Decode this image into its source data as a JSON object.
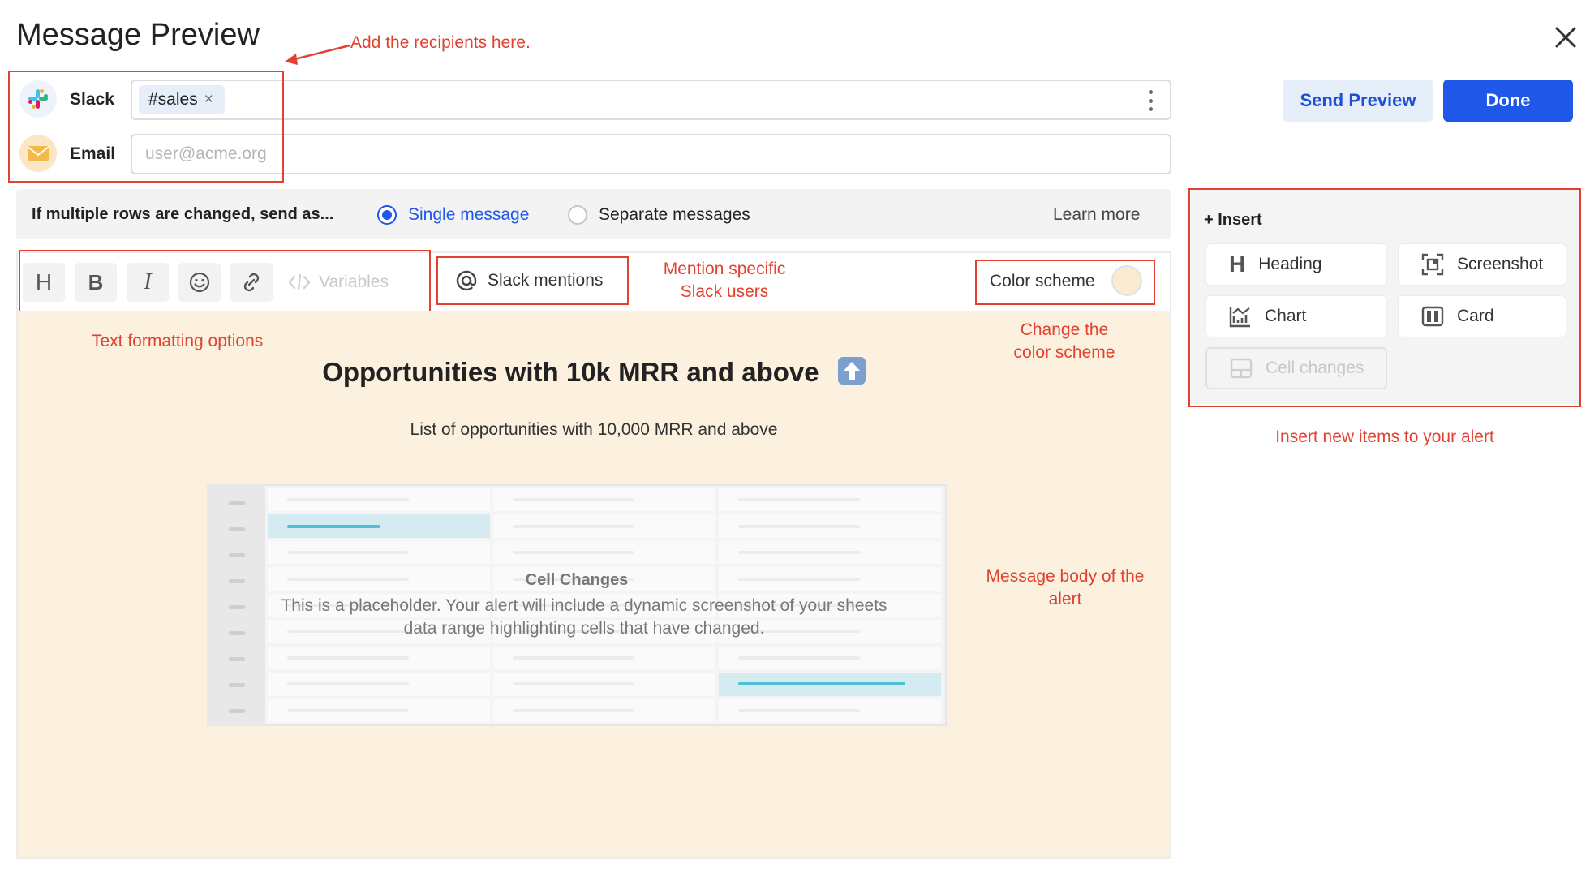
{
  "header": {
    "title": "Message Preview",
    "close_icon": "close-icon"
  },
  "recipients": {
    "slack": {
      "label": "Slack",
      "icon": "slack-icon",
      "chip": "#sales",
      "chip_remove": "×"
    },
    "email": {
      "label": "Email",
      "icon": "envelope-icon",
      "placeholder": "user@acme.org",
      "value": ""
    }
  },
  "actions": {
    "send_preview": "Send Preview",
    "done": "Done"
  },
  "send_mode": {
    "label": "If multiple rows are changed, send as...",
    "options": [
      {
        "label": "Single message",
        "selected": true
      },
      {
        "label": "Separate messages",
        "selected": false
      }
    ],
    "learn_more": "Learn more"
  },
  "toolbar": {
    "heading": "H",
    "bold": "B",
    "italic": "I",
    "variables": "Variables",
    "slack_mentions": "Slack mentions",
    "color_scheme": "Color scheme",
    "color_scheme_swatch": "#f9ecd1"
  },
  "message": {
    "title": "Opportunities with 10k MRR and above",
    "title_emoji": "up-arrow-emoji",
    "subtitle": "List of opportunities with 10,000 MRR and above",
    "placeholder_title": "Cell Changes",
    "placeholder_text": "This is a placeholder. Your alert will include a dynamic screenshot of your sheets data range highlighting cells that have changed."
  },
  "insert": {
    "title": "+ Insert",
    "items": [
      {
        "label": "Heading",
        "icon": "heading-icon",
        "enabled": true
      },
      {
        "label": "Screenshot",
        "icon": "screenshot-icon",
        "enabled": true
      },
      {
        "label": "Chart",
        "icon": "chart-icon",
        "enabled": true
      },
      {
        "label": "Card",
        "icon": "card-icon",
        "enabled": true
      },
      {
        "label": "Cell changes",
        "icon": "cell-changes-icon",
        "enabled": false
      }
    ]
  },
  "annotations": {
    "recipients": "Add the recipients here.",
    "mention_line1": "Mention specific",
    "mention_line2": "Slack users",
    "formatting": "Text formatting options",
    "color_line1": "Change the",
    "color_line2": "color scheme",
    "body_line1": "Message body of the",
    "body_line2": "alert",
    "insert": "Insert new items to your alert"
  },
  "colors": {
    "accent": "#1f57e8",
    "annotation": "#e2412f",
    "body_background": "#fbf1de",
    "highlight_cell": "#d4ecf1"
  }
}
